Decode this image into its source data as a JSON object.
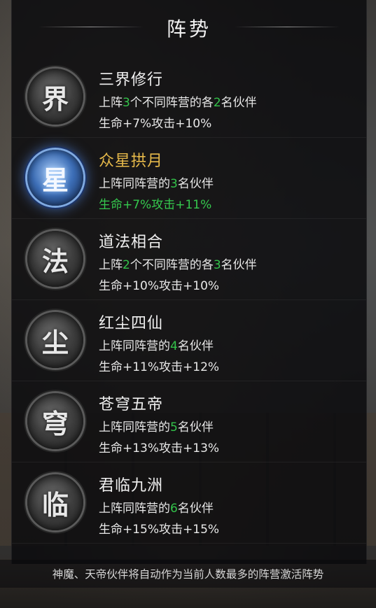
{
  "title": "阵势",
  "rows": [
    {
      "emblem": "界",
      "name": "三界修行",
      "req_a": "上阵",
      "req_num1": "3",
      "req_b": "个不同阵营的各",
      "req_num2": "2",
      "req_c": "名伙伴",
      "bonus": "生命+7%攻击+10%",
      "active": false
    },
    {
      "emblem": "星",
      "name": "众星拱月",
      "req_a": "上阵同阵营的",
      "req_num1": "3",
      "req_b": "名伙伴",
      "bonus": "生命+7%攻击+11%",
      "active": true
    },
    {
      "emblem": "法",
      "name": "道法相合",
      "req_a": "上阵",
      "req_num1": "2",
      "req_b": "个不同阵营的各",
      "req_num2": "3",
      "req_c": "名伙伴",
      "bonus": "生命+10%攻击+10%",
      "active": false
    },
    {
      "emblem": "尘",
      "name": "红尘四仙",
      "req_a": "上阵同阵营的",
      "req_num1": "4",
      "req_b": "名伙伴",
      "bonus": "生命+11%攻击+12%",
      "active": false
    },
    {
      "emblem": "穹",
      "name": "苍穹五帝",
      "req_a": "上阵同阵营的",
      "req_num1": "5",
      "req_b": "名伙伴",
      "bonus": "生命+13%攻击+13%",
      "active": false
    },
    {
      "emblem": "临",
      "name": "君临九洲",
      "req_a": "上阵同阵营的",
      "req_num1": "6",
      "req_b": "名伙伴",
      "bonus": "生命+15%攻击+15%",
      "active": false
    }
  ],
  "footer": "神魔、天帝伙伴将自动作为当前人数最多的阵营激活阵势",
  "colors": {
    "active_name": "#e6b94a",
    "number_green": "#33c24a",
    "active_bonus": "#35c94e"
  }
}
